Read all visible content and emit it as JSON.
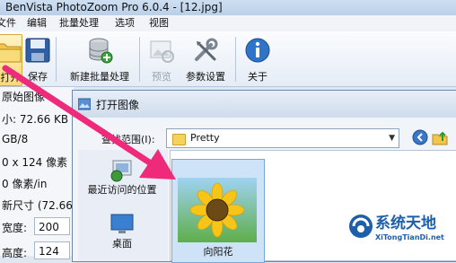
{
  "window": {
    "title": "BenVista PhotoZoom Pro 6.0.4 - [12.jpg]"
  },
  "menu": {
    "items": [
      "文件",
      "编辑",
      "批量处理",
      "选项",
      "视图"
    ]
  },
  "toolbar": {
    "open": "打开",
    "save": "保存",
    "new_batch": "新建批量处理",
    "preview": "预览",
    "settings": "参数设置",
    "about": "关于"
  },
  "left_panel": {
    "lines": [
      "原始图像",
      "小: 72.66 KB",
      "GB/8",
      "0 x 124 像素",
      "0 像素/in",
      "新尺寸 (72.66"
    ],
    "width_label": "宽度:",
    "width_value": "200",
    "height_label": "高度:",
    "height_value": "124"
  },
  "dialog": {
    "title": "打开图像",
    "look_in_label": "查找范围(I):",
    "look_in_value": "Pretty",
    "places": [
      "最近访问的位置",
      "桌面"
    ],
    "file_name": "向阳花"
  },
  "watermark": {
    "name": "系统天地",
    "url": "XiTongTianDi.net"
  },
  "colors": {
    "accent": "#1d5fa8",
    "arrow": "#ee2a7b",
    "selected_button": "#fcd97a"
  }
}
